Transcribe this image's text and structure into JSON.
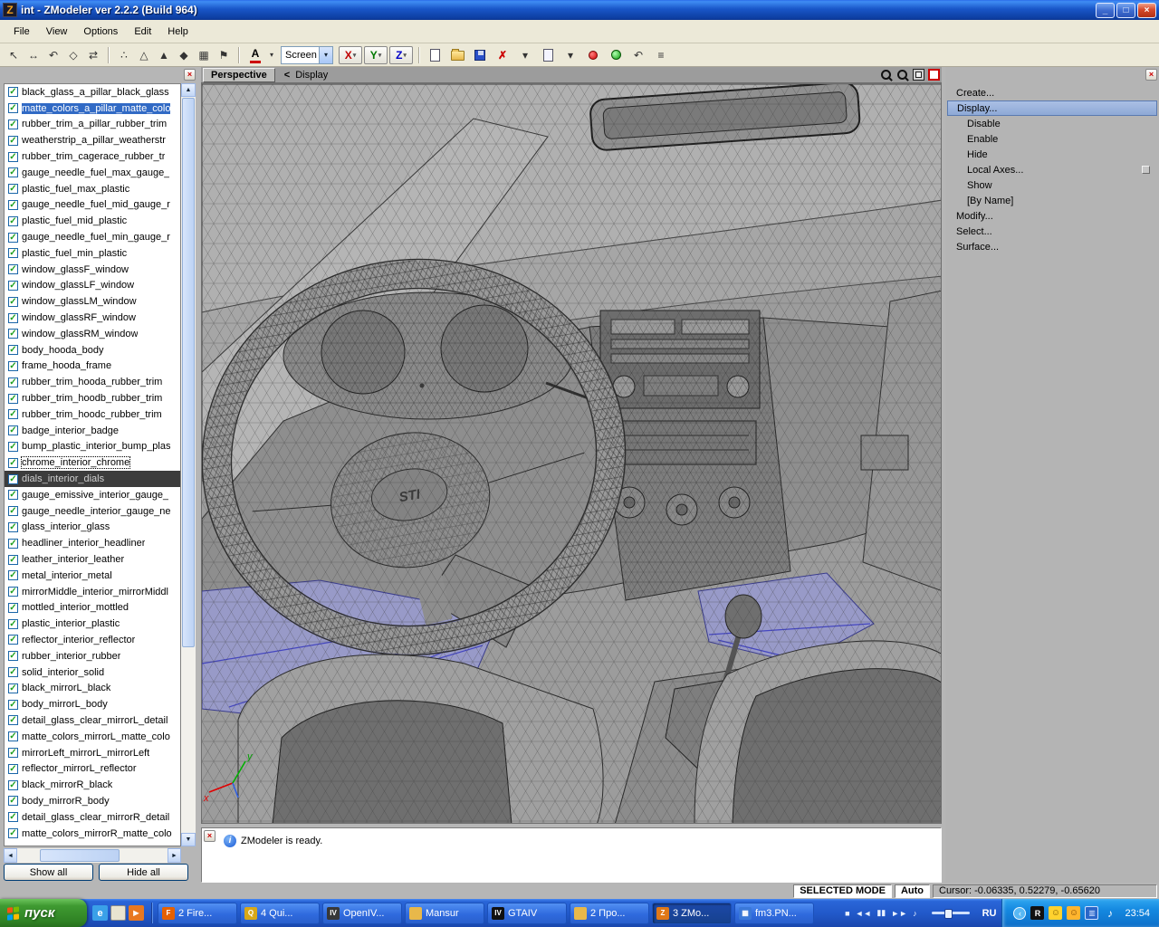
{
  "icons": {
    "close": "×",
    "check": "✓",
    "min": "_",
    "max": "□",
    "dropdown": "▾",
    "info": "i",
    "chevron": "‹"
  },
  "window": {
    "title": "int - ZModeler ver 2.2.2 (Build 964)",
    "app_initial": "Z"
  },
  "menubar": {
    "items": [
      {
        "label": "File"
      },
      {
        "label": "View"
      },
      {
        "label": "Options"
      },
      {
        "label": "Edit"
      },
      {
        "label": "Help"
      }
    ]
  },
  "toolbar": {
    "font_button": "A",
    "screen_select": "Screen",
    "axis": [
      {
        "label": "X",
        "color": "#c00000"
      },
      {
        "label": "Y",
        "color": "#007800"
      },
      {
        "label": "Z",
        "color": "#0000c8"
      }
    ],
    "icons_a": [
      {
        "name": "select-mode-icon",
        "glyph": "↖"
      },
      {
        "name": "move-mode-icon",
        "glyph": "↔"
      },
      {
        "name": "rotate-mode-icon",
        "glyph": "↶"
      },
      {
        "name": "scale-mode-icon",
        "glyph": "◇"
      },
      {
        "name": "mirror-mode-icon",
        "glyph": "⇄"
      }
    ],
    "icons_b": [
      {
        "name": "vertices-level-icon",
        "glyph": "∴"
      },
      {
        "name": "edges-level-icon",
        "glyph": "△"
      },
      {
        "name": "faces-level-icon",
        "glyph": "▲"
      },
      {
        "name": "objects-level-icon",
        "glyph": "◆"
      },
      {
        "name": "uv-level-icon",
        "glyph": "▦"
      },
      {
        "name": "flag-icon",
        "glyph": "⚑"
      }
    ],
    "icons_c": [
      {
        "name": "new-file-icon",
        "cls": "i-page"
      },
      {
        "name": "open-file-icon",
        "cls": "i-folder"
      },
      {
        "name": "save-file-icon",
        "cls": "i-floppy"
      },
      {
        "name": "delete-icon",
        "glyph": "✗",
        "cls": "red"
      },
      {
        "name": "import-dropdown-icon",
        "glyph": "▾"
      },
      {
        "name": "export-file-icon",
        "cls": "i-page2"
      },
      {
        "name": "export-dropdown-icon",
        "glyph": "▾"
      },
      {
        "name": "record-animation-icon",
        "cls": "i-record"
      },
      {
        "name": "material-editor-icon",
        "cls": "i-ball"
      },
      {
        "name": "undo-icon",
        "glyph": "↶"
      },
      {
        "name": "history-list-icon",
        "glyph": "≡"
      }
    ]
  },
  "left_panel": {
    "show_all": "Show all",
    "hide_all": "Hide all",
    "items": [
      {
        "label": "black_glass_a_pillar_black_glass"
      },
      {
        "label": "matte_colors_a_pillar_matte_colo",
        "state": "selected"
      },
      {
        "label": "rubber_trim_a_pillar_rubber_trim"
      },
      {
        "label": "weatherstrip_a_pillar_weatherstr"
      },
      {
        "label": "rubber_trim_cagerace_rubber_tr"
      },
      {
        "label": "gauge_needle_fuel_max_gauge_"
      },
      {
        "label": "plastic_fuel_max_plastic"
      },
      {
        "label": "gauge_needle_fuel_mid_gauge_r"
      },
      {
        "label": "plastic_fuel_mid_plastic"
      },
      {
        "label": "gauge_needle_fuel_min_gauge_r"
      },
      {
        "label": "plastic_fuel_min_plastic"
      },
      {
        "label": "window_glassF_window"
      },
      {
        "label": "window_glassLF_window"
      },
      {
        "label": "window_glassLM_window"
      },
      {
        "label": "window_glassRF_window"
      },
      {
        "label": "window_glassRM_window"
      },
      {
        "label": "body_hooda_body"
      },
      {
        "label": "frame_hooda_frame"
      },
      {
        "label": "rubber_trim_hooda_rubber_trim"
      },
      {
        "label": "rubber_trim_hoodb_rubber_trim"
      },
      {
        "label": "rubber_trim_hoodc_rubber_trim"
      },
      {
        "label": "badge_interior_badge"
      },
      {
        "label": "bump_plastic_interior_bump_plas"
      },
      {
        "label": "chrome_interior_chrome",
        "state": "focus"
      },
      {
        "label": "dials_interior_dials",
        "state": "dark"
      },
      {
        "label": "gauge_emissive_interior_gauge_"
      },
      {
        "label": "gauge_needle_interior_gauge_ne"
      },
      {
        "label": "glass_interior_glass"
      },
      {
        "label": "headliner_interior_headliner"
      },
      {
        "label": "leather_interior_leather"
      },
      {
        "label": "metal_interior_metal"
      },
      {
        "label": "mirrorMiddle_interior_mirrorMiddl"
      },
      {
        "label": "mottled_interior_mottled"
      },
      {
        "label": "plastic_interior_plastic"
      },
      {
        "label": "reflector_interior_reflector"
      },
      {
        "label": "rubber_interior_rubber"
      },
      {
        "label": "solid_interior_solid"
      },
      {
        "label": "black_mirrorL_black"
      },
      {
        "label": "body_mirrorL_body"
      },
      {
        "label": "detail_glass_clear_mirrorL_detail"
      },
      {
        "label": "matte_colors_mirrorL_matte_colo"
      },
      {
        "label": "mirrorLeft_mirrorL_mirrorLeft"
      },
      {
        "label": "reflector_mirrorL_reflector"
      },
      {
        "label": "black_mirrorR_black"
      },
      {
        "label": "body_mirrorR_body"
      },
      {
        "label": "detail_glass_clear_mirrorR_detail"
      },
      {
        "label": "matte_colors_mirrorR_matte_colo"
      }
    ]
  },
  "viewport": {
    "mode_label": "Perspective",
    "back_arrow": "<",
    "breadcrumb": "Display",
    "wheel_logo": "STI"
  },
  "right_menu": {
    "items": [
      {
        "label": "Create..."
      },
      {
        "label": "Display...",
        "cls": "sel"
      },
      {
        "label": "Disable",
        "cls": "sub"
      },
      {
        "label": "Enable",
        "cls": "sub"
      },
      {
        "label": "Hide",
        "cls": "sub"
      },
      {
        "label": "Local Axes...",
        "cls": "sub hasbox"
      },
      {
        "label": "Show",
        "cls": "sub"
      },
      {
        "label": "[By Name]",
        "cls": "sub"
      },
      {
        "label": "Modify..."
      },
      {
        "label": "Select..."
      },
      {
        "label": "Surface..."
      }
    ]
  },
  "status": {
    "message": "ZModeler is ready."
  },
  "mode_bar": {
    "selected_mode": "SELECTED MODE",
    "auto": "Auto",
    "cursor": "Cursor: -0.06335, 0.52279, -0.65620"
  },
  "taskbar": {
    "start": "пуск",
    "quick_launch": [
      {
        "name": "internet-explorer-icon",
        "glyph": "e",
        "cls": "ql-ie"
      },
      {
        "name": "show-desktop-icon",
        "glyph": "",
        "cls": "ql-desk"
      },
      {
        "name": "media-player-icon",
        "glyph": "►",
        "cls": "ql-wmp"
      }
    ],
    "tasks": [
      {
        "label": "2 Fire...",
        "glyph": "F",
        "color": "#e66000"
      },
      {
        "label": "4 Qui...",
        "glyph": "Q",
        "color": "#d8a818"
      },
      {
        "label": "OpenIV...",
        "glyph": "IV",
        "color": "#383838"
      },
      {
        "label": "Mansur",
        "glyph": "",
        "color": "#e8b84a"
      },
      {
        "label": "GTAIV",
        "glyph": "IV",
        "color": "#101010"
      },
      {
        "label": "2 Про...",
        "glyph": "",
        "color": "#e8b84a"
      },
      {
        "label": "3 ZMo...",
        "glyph": "Z",
        "color": "#e07818",
        "state": "active"
      },
      {
        "label": "fm3.PN...",
        "glyph": "▦",
        "color": "#3a78d8"
      }
    ],
    "media_controls": [
      {
        "name": "stop-button",
        "glyph": "■"
      },
      {
        "name": "previous-button",
        "glyph": "◄◄"
      },
      {
        "name": "pause-button",
        "glyph": "▮▮"
      },
      {
        "name": "next-button",
        "glyph": "►►"
      },
      {
        "name": "volume-button",
        "glyph": "♪"
      }
    ],
    "lang": "RU",
    "tray_icons": [
      {
        "name": "rockstar-tray-icon",
        "glyph": "R",
        "cls": "tr-rock"
      },
      {
        "name": "smiley-tray-icon",
        "glyph": "☺",
        "cls": "tr-sm1"
      },
      {
        "name": "qip-tray-icon",
        "glyph": "☺",
        "cls": "tr-sm2"
      },
      {
        "name": "network-tray-icon",
        "glyph": "▥",
        "cls": "tr-net"
      },
      {
        "name": "volume-tray-icon",
        "glyph": "♪",
        "cls": "tr-vol"
      }
    ],
    "time": "23:54"
  }
}
